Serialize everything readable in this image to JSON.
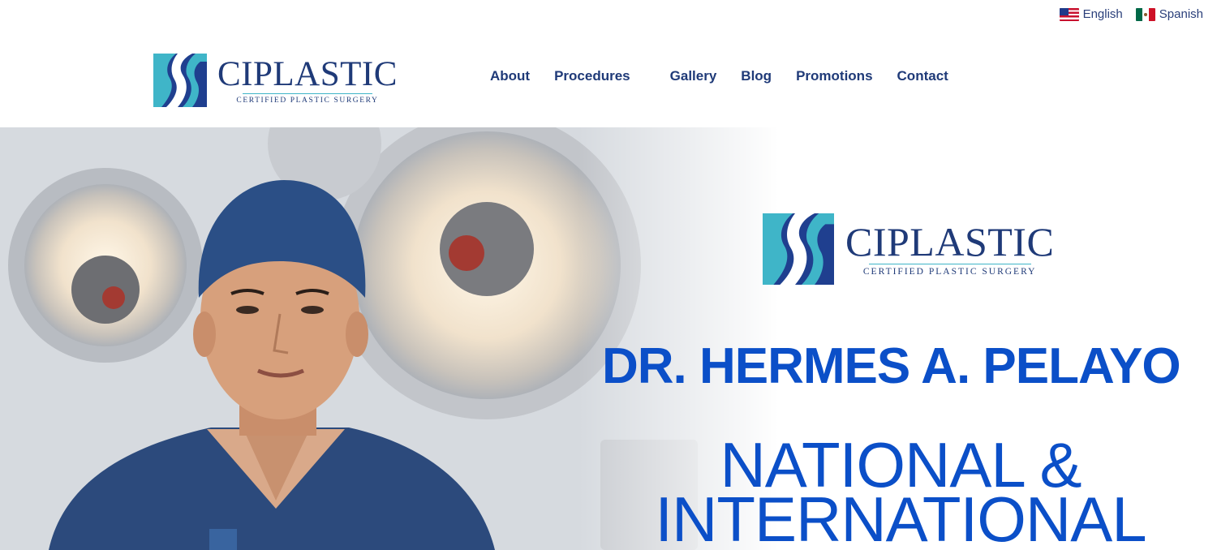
{
  "languages": [
    {
      "label": "English",
      "flag": "us-flag-icon"
    },
    {
      "label": "Spanish",
      "flag": "mexico-flag-icon"
    }
  ],
  "brand": {
    "name": "CIPLASTIC",
    "tagline": "CERTIFIED PLASTIC SURGERY",
    "colors": {
      "navy": "#1f3a78",
      "teal": "#3fb5c8",
      "headline_blue": "#0b4fc8"
    }
  },
  "nav": {
    "items": [
      "About",
      "Procedures",
      "Gallery",
      "Blog",
      "Promotions",
      "Contact"
    ]
  },
  "hero": {
    "doctor_name": "DR. HERMES A. PELAYO",
    "subtitle_line1": "NATIONAL &",
    "subtitle_line2": "INTERNATIONAL"
  }
}
